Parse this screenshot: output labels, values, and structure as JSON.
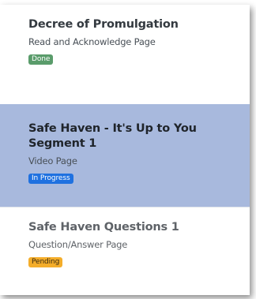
{
  "items": [
    {
      "title": "Decree of Promulgation",
      "subtitle": "Read and Acknowledge Page",
      "status": "Done",
      "status_color": "#5a9c6b"
    },
    {
      "title": "Safe Haven - It's Up to You Segment 1",
      "subtitle": "Video Page",
      "status": "In Progress",
      "status_color": "#1f71e0",
      "selected": true,
      "selected_color": "#a8b9dd"
    },
    {
      "title": "Safe Haven Questions 1",
      "subtitle": "Question/Answer Page",
      "status": "Pending",
      "status_color": "#f4ad2a"
    }
  ]
}
